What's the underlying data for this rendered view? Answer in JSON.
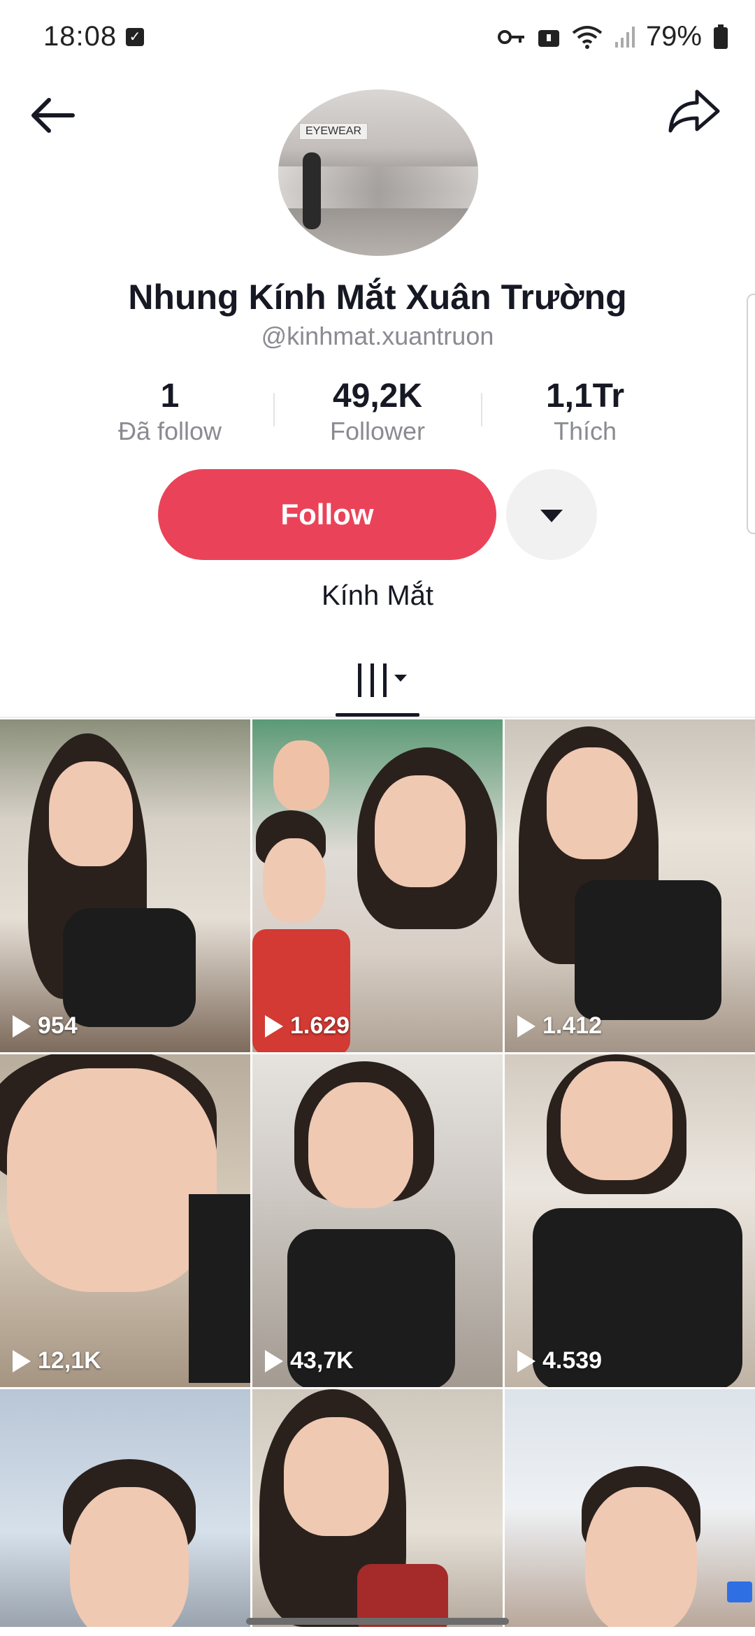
{
  "status_bar": {
    "time": "18:08",
    "battery": "79%",
    "icons": [
      "check-box-icon",
      "key-icon",
      "vpn-icon",
      "wifi-icon",
      "signal-icon",
      "battery-icon"
    ]
  },
  "header": {
    "back_icon": "arrow-left-icon",
    "share_icon": "share-arrow-icon",
    "avatar_sign": "EYEWEAR"
  },
  "profile": {
    "name": "Nhung Kính Mắt Xuân Trường",
    "handle": "@kinhmat.xuantruon",
    "bio": "Kính Mắt"
  },
  "stats": [
    {
      "value": "1",
      "label": "Đã follow"
    },
    {
      "value": "49,2K",
      "label": "Follower"
    },
    {
      "value": "1,1Tr",
      "label": "Thích"
    }
  ],
  "actions": {
    "follow_label": "Follow",
    "more_icon": "caret-down-icon"
  },
  "tabs": {
    "videos_icon": "grid-bars-icon"
  },
  "videos": [
    {
      "views": "954"
    },
    {
      "views": "1.629"
    },
    {
      "views": "1.412"
    },
    {
      "views": "12,1K"
    },
    {
      "views": "43,7K"
    },
    {
      "views": "4.539"
    },
    {
      "views": ""
    },
    {
      "views": ""
    },
    {
      "views": ""
    }
  ],
  "colors": {
    "follow_button": "#ea4359",
    "text_primary": "#161823",
    "text_secondary": "#8a8b91"
  }
}
